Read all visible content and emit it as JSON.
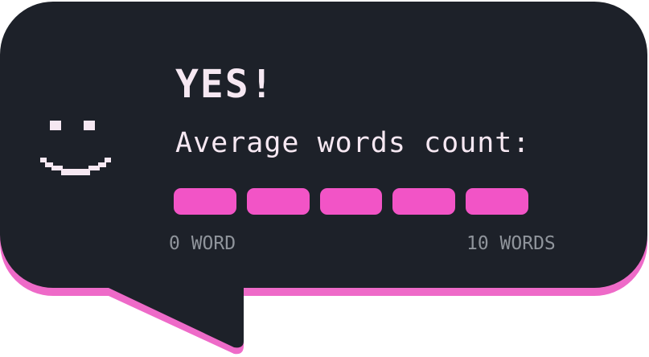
{
  "card": {
    "title": "YES!",
    "subtitle": "Average words count:",
    "scale_min_label": "0 WORD",
    "scale_max_label": "10 WORDS"
  },
  "meter": {
    "segments_total": 5,
    "segments_filled": 5,
    "value_fraction": 1.0
  },
  "mascot": {
    "icon": "smiley-face-icon"
  },
  "colors": {
    "bubble_background": "#1d2129",
    "bubble_shadow": "#ee6ac8",
    "text_primary": "#f6e8f2",
    "text_muted": "#8f949b",
    "meter_fill": "#f254c6",
    "meter_empty": "#3a2d3f"
  }
}
